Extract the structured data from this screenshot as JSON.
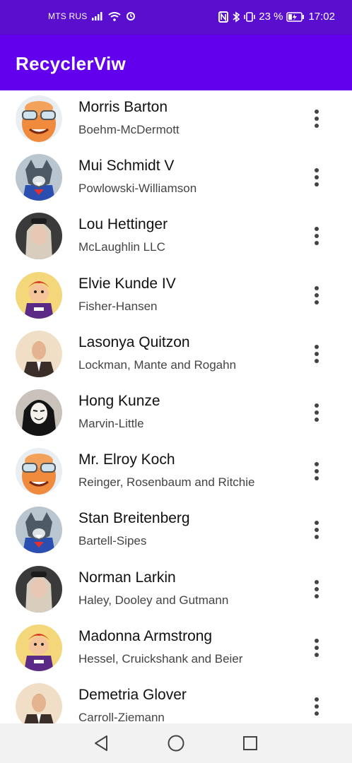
{
  "status_bar": {
    "carrier": "MTS RUS",
    "battery": "23 %",
    "time": "17:02",
    "icons": [
      "signal-icon",
      "wifi-icon",
      "sync-icon",
      "nfc-icon",
      "bluetooth-icon",
      "vibrate-icon",
      "battery-icon"
    ]
  },
  "app_bar": {
    "title": "RecyclerViw"
  },
  "list": {
    "items": [
      {
        "name": "Morris Barton",
        "company": "Boehm-McDermott",
        "avatar": "cartoon-man-avatar"
      },
      {
        "name": "Mui Schmidt V",
        "company": "Powlowski-Williamson",
        "avatar": "wolf-superhero-avatar"
      },
      {
        "name": "Lou Hettinger",
        "company": "McLaughlin LLC",
        "avatar": "blonde-woman-avatar"
      },
      {
        "name": "Elvie Kunde IV",
        "company": "Fisher-Hansen",
        "avatar": "cartoon-character-avatar"
      },
      {
        "name": "Lasonya Quitzon",
        "company": "Lockman, Mante and Rogahn",
        "avatar": "man-in-suit-avatar"
      },
      {
        "name": "Hong Kunze",
        "company": "Marvin-Little",
        "avatar": "masked-person-avatar"
      },
      {
        "name": "Mr. Elroy Koch",
        "company": "Reinger, Rosenbaum and Ritchie",
        "avatar": "cartoon-man-avatar"
      },
      {
        "name": "Stan Breitenberg",
        "company": "Bartell-Sipes",
        "avatar": "wolf-superhero-avatar"
      },
      {
        "name": "Norman Larkin",
        "company": "Haley, Dooley and Gutmann",
        "avatar": "blonde-woman-avatar"
      },
      {
        "name": "Madonna Armstrong",
        "company": "Hessel, Cruickshank and Beier",
        "avatar": "cartoon-character-avatar"
      },
      {
        "name": "Demetria Glover",
        "company": "Carroll-Ziemann",
        "avatar": "man-in-suit-avatar"
      }
    ]
  },
  "nav_bar": {
    "buttons": [
      "back-icon",
      "home-icon",
      "recents-icon"
    ]
  },
  "colors": {
    "status_bar": "#5a0fcf",
    "app_bar": "#6200ee",
    "background": "#ffffff",
    "nav_bar": "#f2f2f2"
  }
}
